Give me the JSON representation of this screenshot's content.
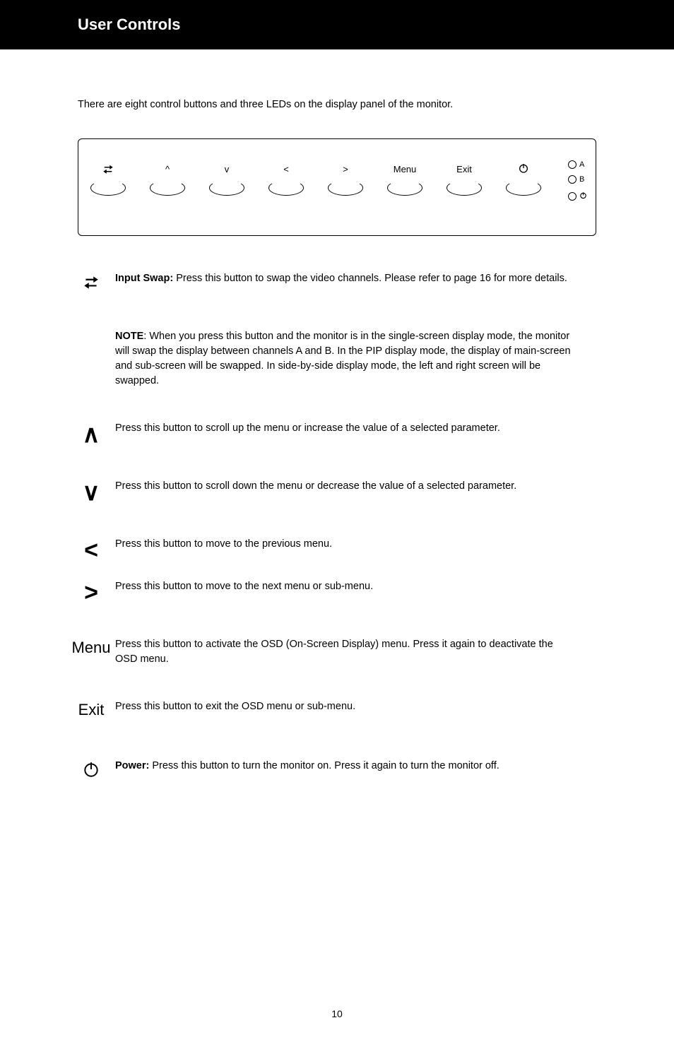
{
  "header": {
    "title": "User Controls"
  },
  "intro": "There are eight control buttons and three LEDs on the display panel of the monitor.",
  "panel": {
    "buttons": [
      {
        "name": "swap",
        "label_type": "icon-swap"
      },
      {
        "name": "up",
        "label": "^"
      },
      {
        "name": "down",
        "label": "v"
      },
      {
        "name": "left",
        "label": "<"
      },
      {
        "name": "right",
        "label": ">"
      },
      {
        "name": "menu",
        "label": "Menu"
      },
      {
        "name": "exit",
        "label": "Exit"
      },
      {
        "name": "power",
        "label_type": "icon-power"
      }
    ],
    "leds": [
      {
        "label": "A"
      },
      {
        "label": "B"
      },
      {
        "label_type": "icon-power-small"
      }
    ]
  },
  "definitions": {
    "swap": {
      "label": "Input Swap:",
      "text": " Press this button to swap the video channels. Please refer to page 16 for more details."
    },
    "note": {
      "label": "NOTE",
      "text": ": When you press this button and the monitor is in the single-screen display mode, the monitor will swap the display between channels A and B. In the PIP display mode, the display of main-screen and sub-screen will be swapped. In side-by-side display mode, the left and right screen will be swapped."
    },
    "up": {
      "text": "Press this button to scroll up the menu or increase the value of a selected parameter."
    },
    "down": {
      "text": "Press this button to scroll down the menu or decrease the value of a selected parameter."
    },
    "left": {
      "text": "Press this button to move to the previous menu."
    },
    "right": {
      "text": "Press this button to move to the next menu or sub-menu."
    },
    "menu": {
      "label": "Menu",
      "text": "Press this button to activate the OSD (On-Screen Display) menu. Press it again to deactivate the OSD menu."
    },
    "exit": {
      "label": "Exit",
      "text": "Press this button to exit the OSD menu or sub-menu."
    },
    "power": {
      "label": "Power:",
      "text": " Press this button to turn the monitor on. Press it again to turn the monitor off."
    }
  },
  "page_number": "10"
}
